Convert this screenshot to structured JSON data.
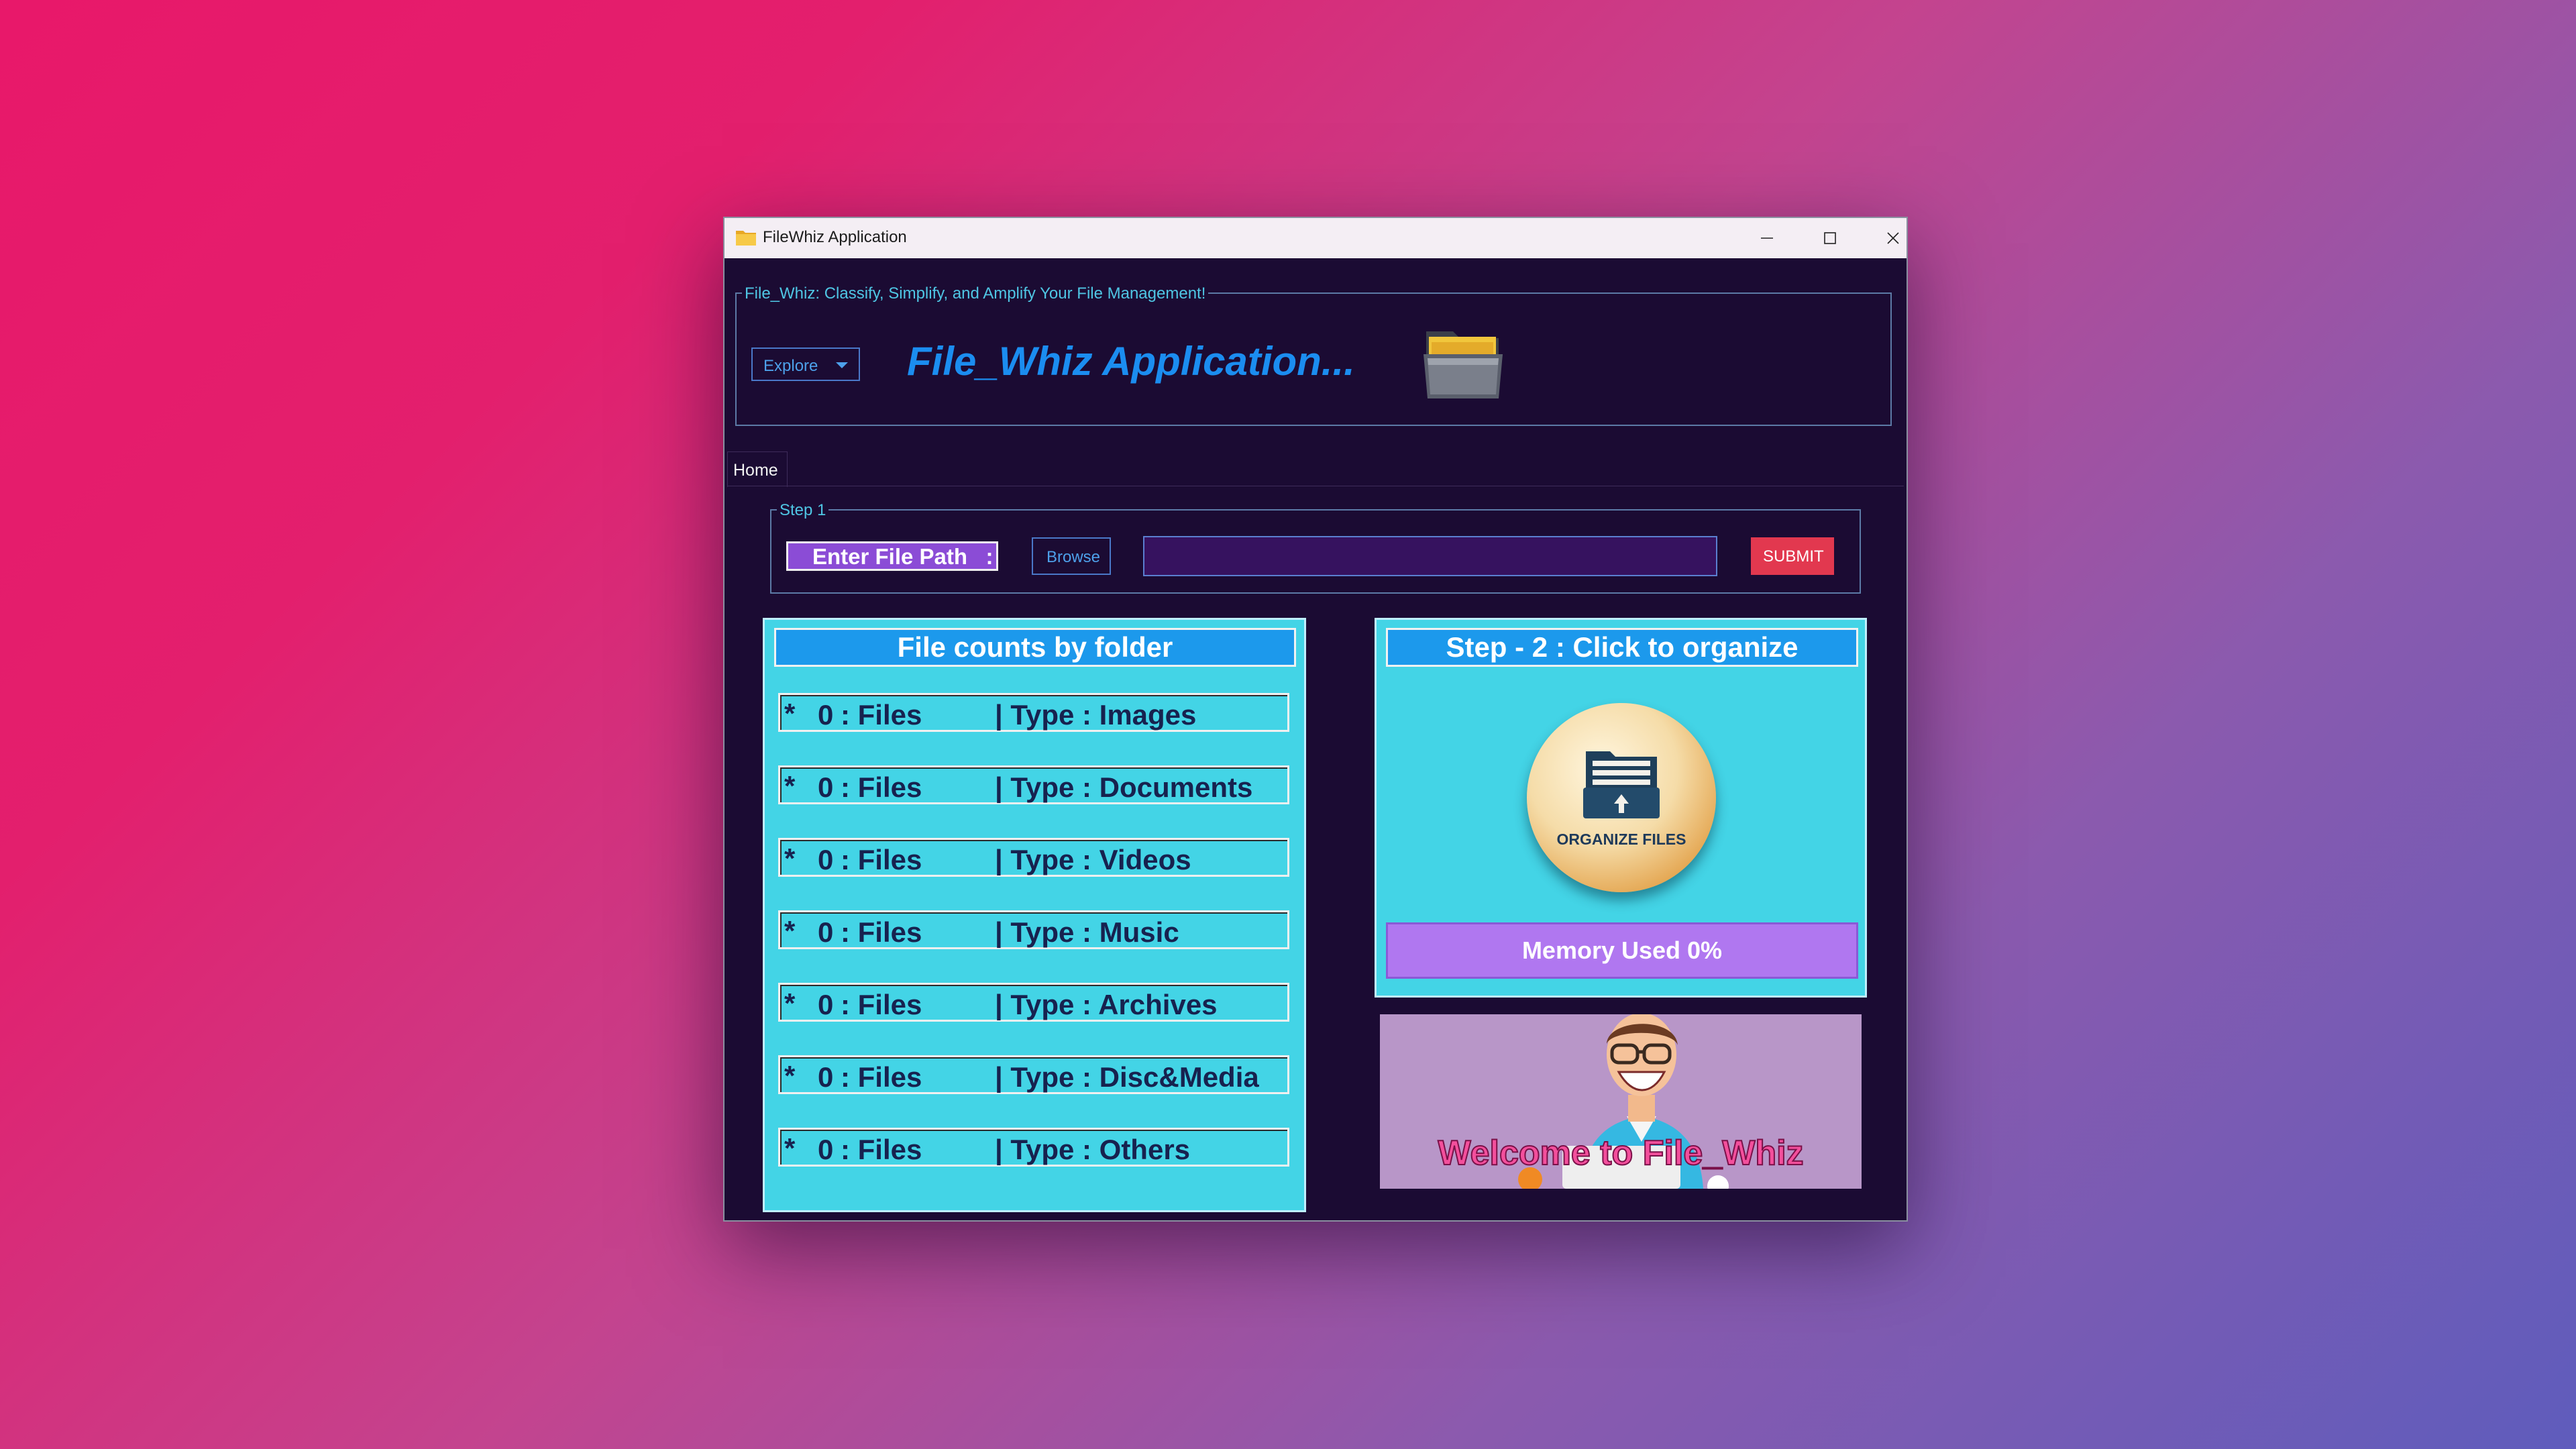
{
  "window": {
    "title": "FileWhiz Application"
  },
  "header": {
    "legend": "File_Whiz: Classify, Simplify, and Amplify Your File Management!",
    "explore_label": "Explore",
    "app_title": "File_Whiz Application..."
  },
  "tabs": [
    {
      "label": "Home",
      "selected": true
    }
  ],
  "step1": {
    "legend": "Step 1",
    "enter_path_label": "Enter File Path   :",
    "browse_label": "Browse",
    "path_value": "",
    "submit_label": "SUBMIT"
  },
  "file_counts": {
    "title": "File counts by folder",
    "rows": [
      {
        "count": "0",
        "files_label": ": Files",
        "type_label": "| Type : Images"
      },
      {
        "count": "0",
        "files_label": ": Files",
        "type_label": "| Type : Documents"
      },
      {
        "count": "0",
        "files_label": ": Files",
        "type_label": "| Type : Videos"
      },
      {
        "count": "0",
        "files_label": ": Files",
        "type_label": "| Type : Music"
      },
      {
        "count": "0",
        "files_label": ": Files",
        "type_label": "| Type : Archives"
      },
      {
        "count": "0",
        "files_label": ": Files",
        "type_label": "| Type : Disc&Media"
      },
      {
        "count": "0",
        "files_label": ": Files",
        "type_label": "| Type : Others"
      }
    ]
  },
  "organize": {
    "title": "Step - 2 : Click to organize",
    "button_label": "ORGANIZE FILES",
    "memory_label": "Memory Used 0%",
    "memory_percent": 0
  },
  "welcome": {
    "text": "Welcome to File_Whiz"
  },
  "colors": {
    "window_bg": "#1b0b33",
    "accent_blue": "#1c99ec",
    "panel_cyan": "#43d4e6",
    "submit_red": "#e2384f",
    "memory_purple": "#b077f0",
    "enter_path_purple": "#8b4cd6"
  },
  "icons": [
    "folder-app-icon",
    "minimize-icon",
    "maximize-icon",
    "close-icon",
    "chevron-down-icon",
    "folder-logo-icon",
    "file-box-upload-icon"
  ]
}
